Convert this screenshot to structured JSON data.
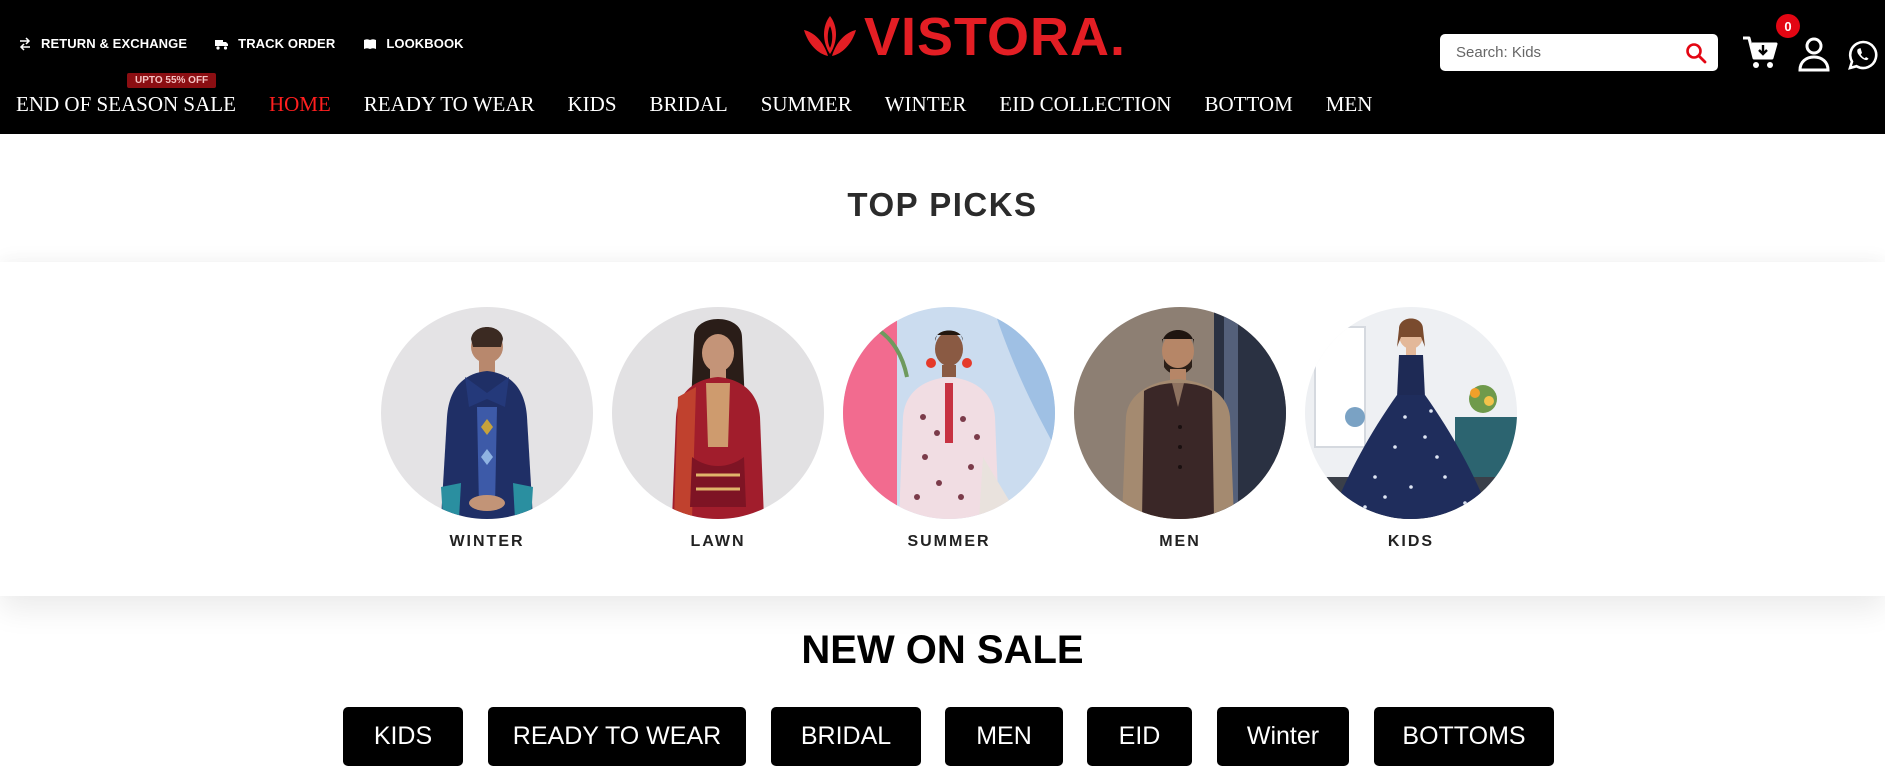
{
  "header": {
    "utility_links": [
      {
        "label": "RETURN & EXCHANGE",
        "icon": "exchange-icon"
      },
      {
        "label": "TRACK ORDER",
        "icon": "truck-icon"
      },
      {
        "label": "LOOKBOOK",
        "icon": "book-icon"
      }
    ],
    "logo_text": "VISTORA.",
    "search": {
      "placeholder": "Search: Kids"
    },
    "cart_count": "0",
    "sale_tag": "UPTO 55% OFF",
    "nav": [
      {
        "label": "END OF SEASON SALE",
        "active": false
      },
      {
        "label": "HOME",
        "active": true
      },
      {
        "label": "READY TO WEAR",
        "active": false
      },
      {
        "label": "KIDS",
        "active": false
      },
      {
        "label": "BRIDAL",
        "active": false
      },
      {
        "label": "SUMMER",
        "active": false
      },
      {
        "label": "WINTER",
        "active": false
      },
      {
        "label": "EID COLLECTION",
        "active": false
      },
      {
        "label": "BOTTOM",
        "active": false
      },
      {
        "label": "MEN",
        "active": false
      }
    ]
  },
  "top_picks": {
    "title": "TOP PICKS",
    "items": [
      {
        "label": "WINTER"
      },
      {
        "label": "LAWN"
      },
      {
        "label": "SUMMER"
      },
      {
        "label": "MEN"
      },
      {
        "label": "KIDS"
      }
    ]
  },
  "new_on_sale": {
    "title": "NEW ON SALE",
    "buttons": [
      "KIDS",
      "READY TO WEAR",
      "BRIDAL",
      "MEN",
      "EID",
      "Winter",
      "BOTTOMS"
    ]
  },
  "colors": {
    "brand_red": "#e31e24",
    "header_bg": "#000000",
    "active_nav": "#ff1f1f",
    "badge_red": "#e30613"
  }
}
